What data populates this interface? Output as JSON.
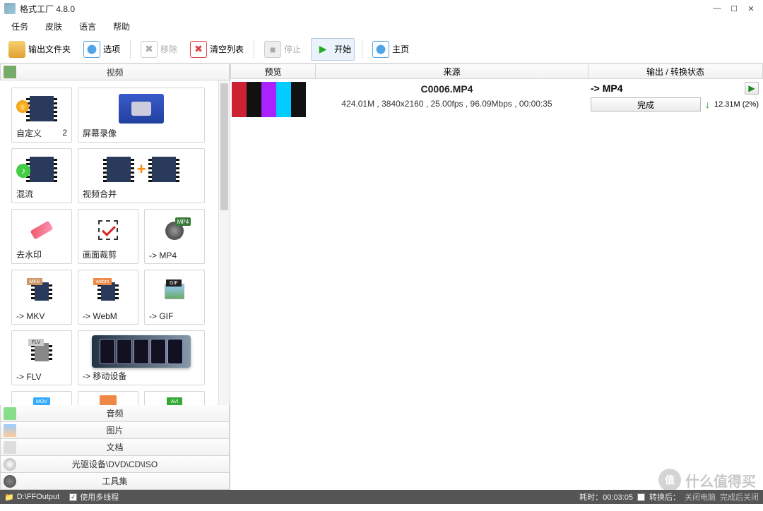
{
  "app": {
    "title": "格式工厂 4.8.0"
  },
  "menu": {
    "task": "任务",
    "skin": "皮肤",
    "lang": "语言",
    "help": "帮助"
  },
  "toolbar": {
    "output_folder": "输出文件夹",
    "options": "选项",
    "remove": "移除",
    "clear": "清空列表",
    "stop": "停止",
    "start": "开始",
    "home": "主页"
  },
  "categories": {
    "video": "视频",
    "audio": "音频",
    "picture": "图片",
    "document": "文档",
    "disc": "光驱设备\\DVD\\CD\\ISO",
    "tools": "工具集"
  },
  "tiles": {
    "custom": "自定义",
    "custom_badge": "2",
    "screen_record": "屏幕录像",
    "mix": "混流",
    "merge": "视频合并",
    "dewatermark": "去水印",
    "crop": "画面裁剪",
    "to_mp4": "-> MP4",
    "to_mkv": "-> MKV",
    "to_webm": "-> WebM",
    "to_gif": "-> GIF",
    "to_flv": "-> FLV",
    "to_mobile": "-> 移动设备"
  },
  "columns": {
    "preview": "预览",
    "source": "来源",
    "output": "输出 / 转换状态"
  },
  "task": {
    "filename": "C0006.MP4",
    "info": "424.01M , 3840x2160 , 25.00fps , 96.09Mbps , 00:00:35",
    "output": "-> MP4",
    "status": "完成",
    "size_pct": "12.31M  (2%)"
  },
  "statusbar": {
    "path": "D:\\FFOutput",
    "multithread": "使用多线程",
    "elapsed": "耗时：00:03:05",
    "remaining_label": "转换后：",
    "remaining_action": "关闭电脑",
    "done_exit": "完成后关闭"
  },
  "watermark": "什么值得买"
}
